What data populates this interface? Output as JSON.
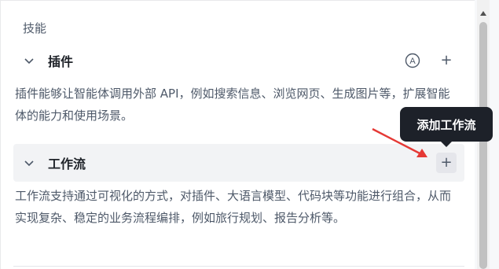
{
  "skills": {
    "section_title": "技能",
    "plugin": {
      "label": "插件",
      "description": "插件能够让智能体调用外部 API，例如搜索信息、浏览网页、生成图片等，扩展智能体的能力和使用场景。",
      "auto_icon": "A",
      "add_symbol": "+"
    },
    "workflow": {
      "label": "工作流",
      "description": "工作流支持通过可视化的方式，对插件、大语言模型、代码块等功能进行组合，从而实现复杂、稳定的业务流程编排，例如旅行规划、报告分析等。",
      "add_symbol": "+",
      "tooltip": "添加工作流"
    }
  },
  "colors": {
    "annotation_arrow": "#e53935",
    "tooltip_bg": "#1d2129",
    "workflow_row_bg": "#f2f3f5"
  }
}
